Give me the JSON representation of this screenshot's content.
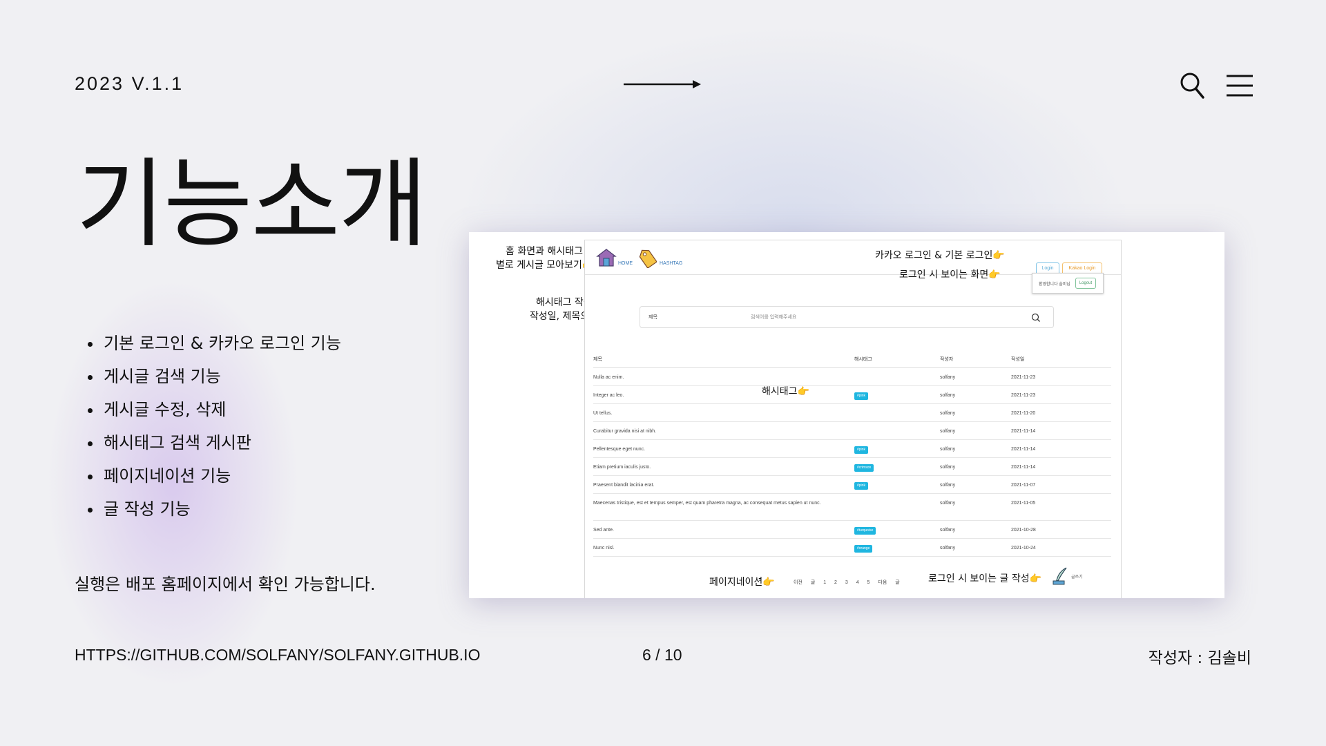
{
  "header": {
    "version": "2023 V.1.1"
  },
  "title": "기능소개",
  "features": [
    "기본 로그인 & 카카오 로그인 기능",
    "게시글 검색 기능",
    "게시글 수정, 삭제",
    "해시태그 검색 게시판",
    "페이지네이션 기능",
    "글 작성 기능"
  ],
  "note": "실행은 배포 홈페이지에서 확인 가능합니다.",
  "footer": {
    "url": "HTTPS://GITHUB.COM/SOLFANY/SOLFANY.GITHUB.IO",
    "page": "6 / 10",
    "author": "작성자 :  김솔비"
  },
  "screenshot": {
    "annotations": {
      "home_hashtag_line1": "홈 화면과 해시태그",
      "home_hashtag_line2": "별로 게시글 모아보기",
      "kakao_login": "카카오 로그인 & 기본 로그인",
      "logged_in_screen": "로그인 시 보이는 화면",
      "search_line1": "해시태그 작성자,",
      "search_line2": "작성일, 제목으로 검색",
      "hashtag": "해시태그",
      "pagination": "페이지네이션",
      "write_when_logged_in": "로그인 시 보이는 글 작성"
    },
    "nav": {
      "home_label": "HOME",
      "hashtag_label": "HASHTAG",
      "login_button": "Login",
      "kakao_login_button": "Kakao Login",
      "welcome_text": "환영합니다 솔비님",
      "logout_button": "Logout"
    },
    "search": {
      "label": "제목",
      "placeholder": "검색어를 입력해주세요"
    },
    "table": {
      "headers": [
        "제목",
        "해시태그",
        "작성자",
        "작성일"
      ],
      "rows": [
        {
          "title": "Nulla ac enim.",
          "tag": "",
          "writer": "solfany",
          "date": "2021-11-23"
        },
        {
          "title": "Integer ac leo.",
          "tag": "#pink",
          "writer": "solfany",
          "date": "2021-11-23"
        },
        {
          "title": "Ut tellus.",
          "tag": "",
          "writer": "solfany",
          "date": "2021-11-20"
        },
        {
          "title": "Curabitur gravida nisi at nibh.",
          "tag": "",
          "writer": "solfany",
          "date": "2021-11-14"
        },
        {
          "title": "Pellentesque eget nunc.",
          "tag": "#pink",
          "writer": "solfany",
          "date": "2021-11-14"
        },
        {
          "title": "Etiam pretium iaculis justo.",
          "tag": "#crimson",
          "writer": "solfany",
          "date": "2021-11-14"
        },
        {
          "title": "Praesent blandit lacinia erat.",
          "tag": "#pink",
          "writer": "solfany",
          "date": "2021-11-07"
        },
        {
          "title": "Maecenas tristique, est et tempus semper, est quam pharetra magna, ac consequat metus sapien ut nunc.",
          "tag": "",
          "writer": "solfany",
          "date": "2021-11-05"
        },
        {
          "title": "Sed ante.",
          "tag": "#turquoise",
          "writer": "solfany",
          "date": "2021-10-28"
        },
        {
          "title": "Nunc nisl.",
          "tag": "#orange",
          "writer": "solfany",
          "date": "2021-10-24"
        }
      ]
    },
    "pagination": "이전 글 1 2 3 4 5 다음 글",
    "write_label": "글쓰기"
  }
}
